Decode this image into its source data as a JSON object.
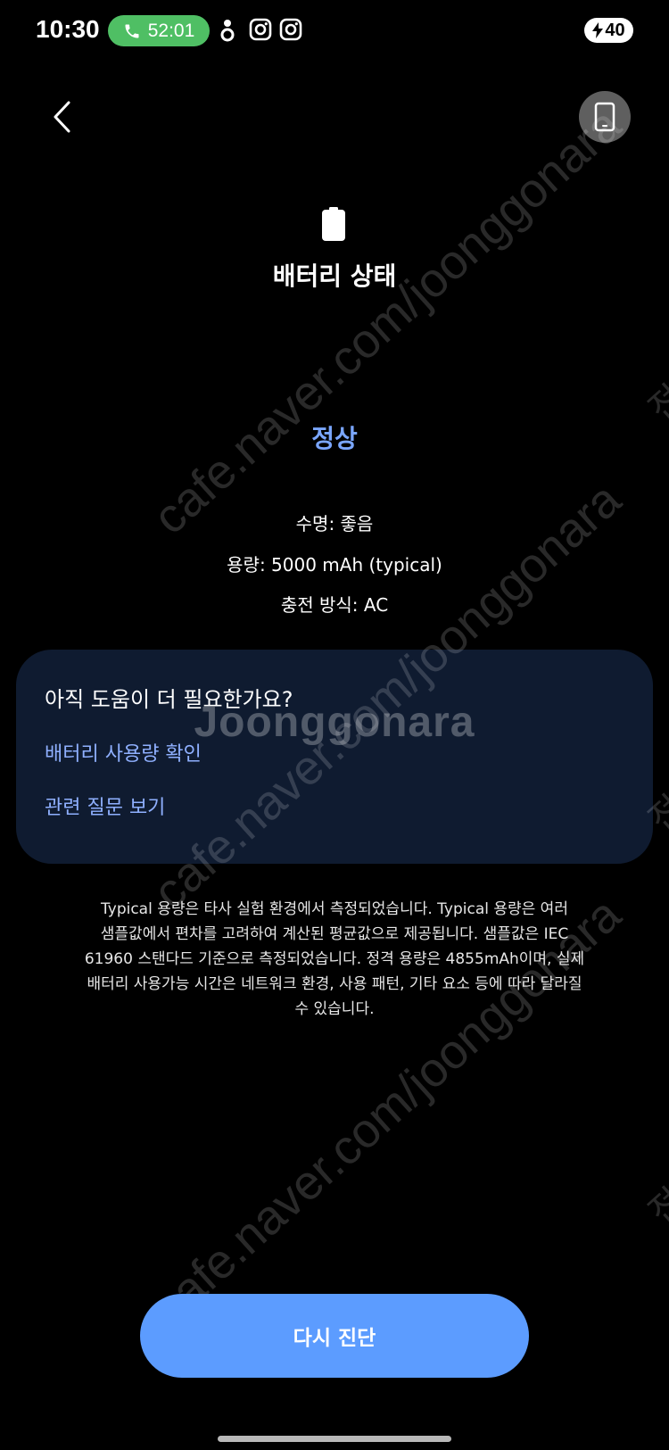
{
  "status_bar": {
    "time": "10:30",
    "call_duration": "52:01",
    "battery_level": "40"
  },
  "header": {
    "title": "배터리 상태"
  },
  "result": {
    "status": "정상",
    "status_color": "#7aa6ff"
  },
  "details": {
    "lifespan": "수명: 좋음",
    "capacity": "용량: 5000 mAh (typical)",
    "charging": "충전 방식: AC"
  },
  "help_card": {
    "title": "아직 도움이 더 필요한가요?",
    "link_usage": "배터리 사용량 확인",
    "link_faq": "관련 질문 보기"
  },
  "disclaimer": {
    "line1": "Typical 용량은 타사 실험 환경에서 측정되었습니다. Typical 용량은 여러",
    "line2": "샘플값에서 편차를 고려하여 계산된 평균값으로 제공됩니다. 샘플값은 IEC",
    "line3": "61960 스탠다드 기준으로 측정되었습니다. 정격 용량은 4855mAh이며, 실제",
    "line4": "배터리 사용가능 시간은 네트워크 환경, 사용 패턴, 기타 요소 등에 따라 달라질",
    "line5": "수 있습니다."
  },
  "actions": {
    "retest_label": "다시 진단"
  },
  "watermarks": {
    "url_text": "cafe.naver.com/joonggonara",
    "logo_text": "Joonggonara",
    "edge_text": "전"
  },
  "colors": {
    "background": "#000000",
    "accent": "#5c9cff",
    "card": "#0f1b30",
    "link": "#8fb0ff",
    "call_pill": "#4fbf64"
  },
  "icons": {
    "call": "phone-icon",
    "back": "chevron-left-icon",
    "device": "phone-device-icon",
    "battery": "battery-icon"
  }
}
